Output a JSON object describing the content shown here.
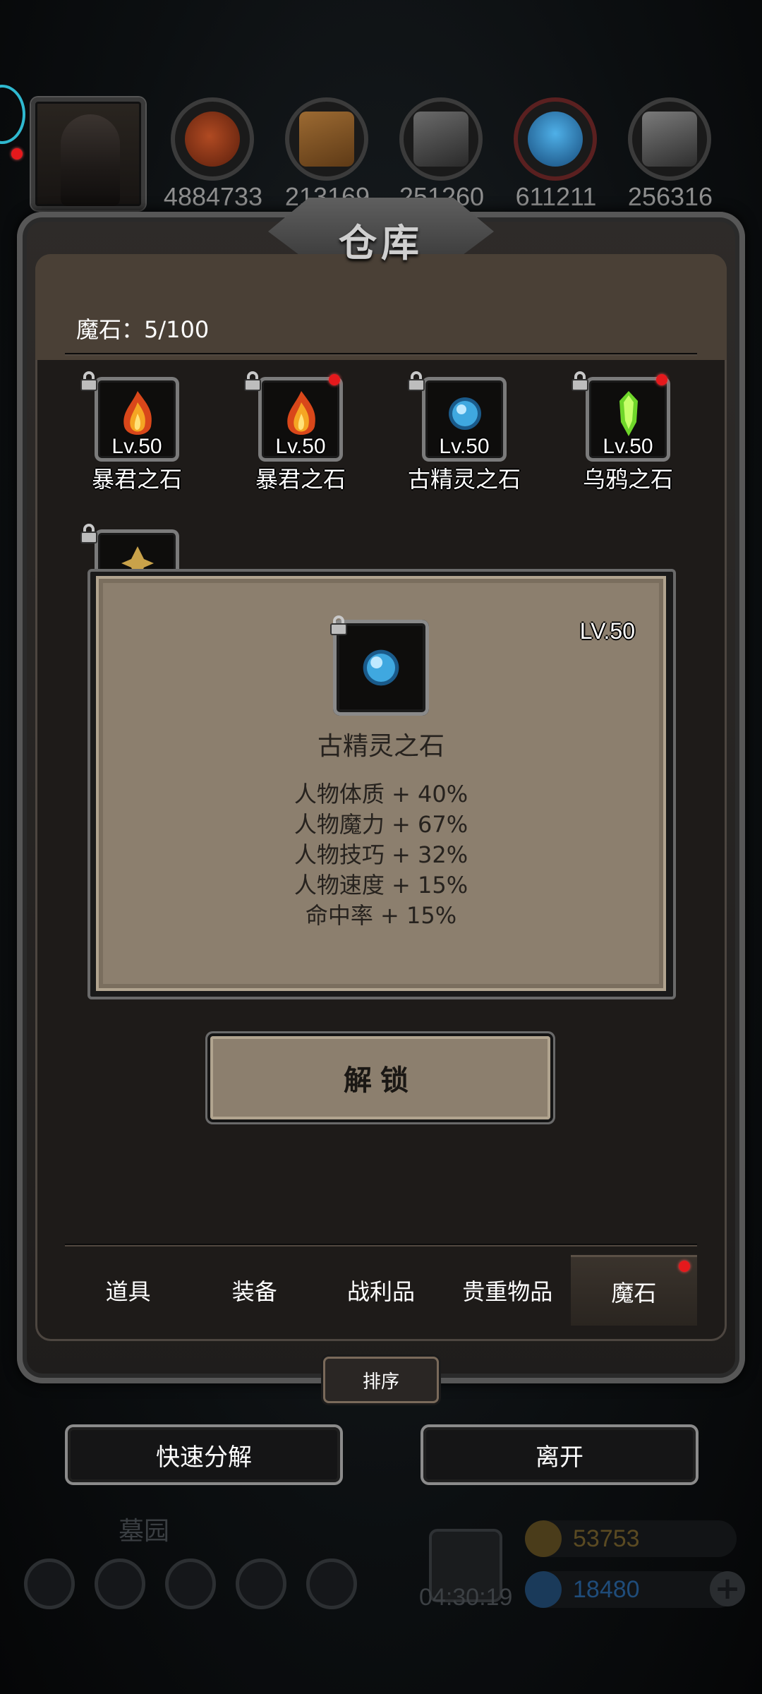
{
  "resources": {
    "values": [
      "4884733",
      "213169",
      "251260",
      "611211",
      "256316"
    ],
    "icons": [
      "meat-icon",
      "wood-icon",
      "iron-ore-icon",
      "crystal-icon",
      "steel-ingot-icon"
    ]
  },
  "warehouse": {
    "title": "仓库",
    "count": "魔石：5/100"
  },
  "items": [
    {
      "level": "Lv.50",
      "name": "暴君之石",
      "gem": "fire",
      "badge": false
    },
    {
      "level": "Lv.50",
      "name": "暴君之石",
      "gem": "fire",
      "badge": true
    },
    {
      "level": "Lv.50",
      "name": "古精灵之石",
      "gem": "blue",
      "badge": false
    },
    {
      "level": "Lv.50",
      "name": "乌鸦之石",
      "gem": "green",
      "badge": true
    }
  ],
  "detail": {
    "level": "LV.50",
    "name": "古精灵之石",
    "stats": [
      "人物体质 + 40%",
      "人物魔力 + 67%",
      "人物技巧 + 32%",
      "人物速度 + 15%",
      "命中率 + 15%"
    ],
    "unlock_label": "解锁"
  },
  "tabs": [
    {
      "label": "道具",
      "active": false
    },
    {
      "label": "装备",
      "active": false
    },
    {
      "label": "战利品",
      "active": false
    },
    {
      "label": "贵重物品",
      "active": false
    },
    {
      "label": "魔石",
      "active": true
    }
  ],
  "sort_label": "排序",
  "actions": {
    "quick_decompose": "快速分解",
    "leave": "离开"
  },
  "hud": {
    "location": "墓园",
    "timer": "04:30:19",
    "gold": "53753",
    "gems": "18480",
    "plus": "+"
  },
  "colors": {
    "gold": "#5a4a22",
    "gem": "#1f4c7a",
    "badge": "#e5191c"
  }
}
